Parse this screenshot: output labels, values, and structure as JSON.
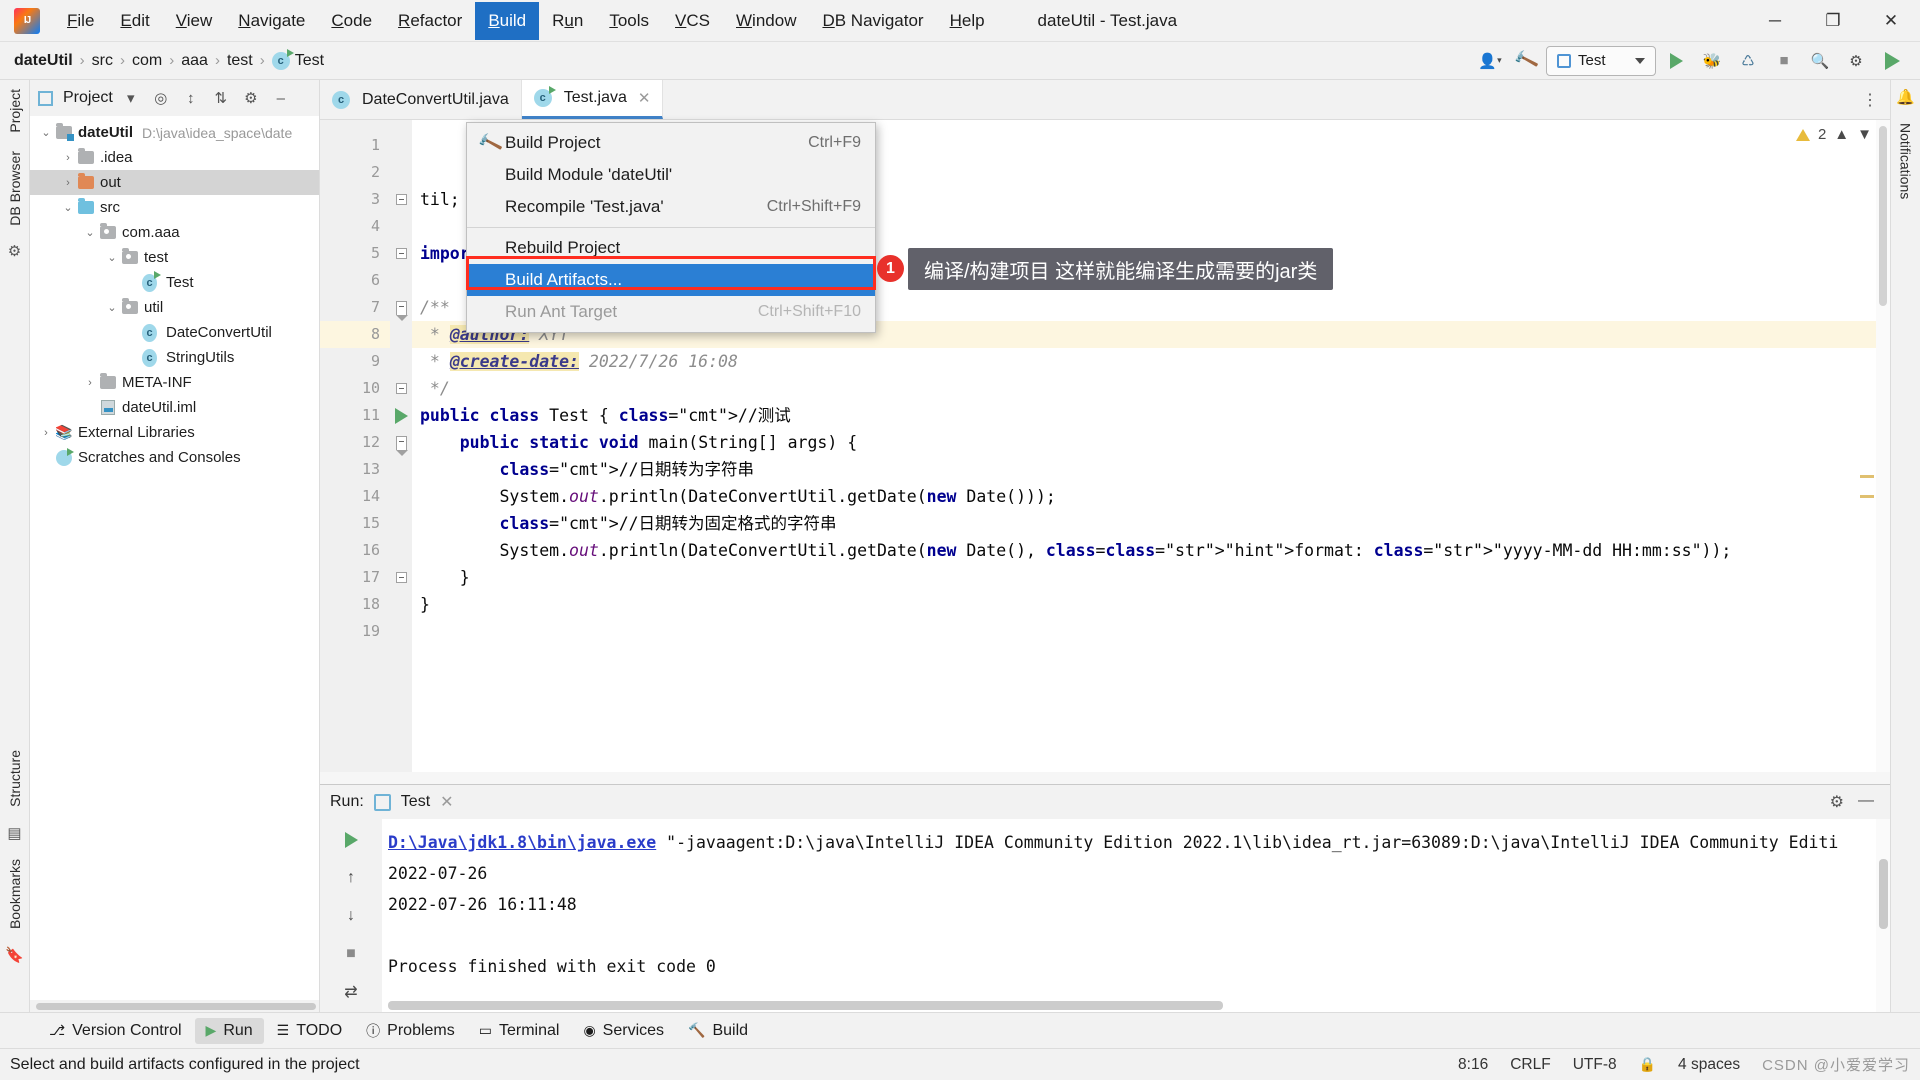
{
  "window": {
    "title": "dateUtil - Test.java"
  },
  "menubar": {
    "items": [
      {
        "label": "File",
        "accel": "F"
      },
      {
        "label": "Edit",
        "accel": "E"
      },
      {
        "label": "View",
        "accel": "V"
      },
      {
        "label": "Navigate",
        "accel": "N"
      },
      {
        "label": "Code",
        "accel": "C"
      },
      {
        "label": "Refactor",
        "accel": "R"
      },
      {
        "label": "Build",
        "accel": "B"
      },
      {
        "label": "Run",
        "accel": "u"
      },
      {
        "label": "Tools",
        "accel": "T"
      },
      {
        "label": "VCS",
        "accel": "V"
      },
      {
        "label": "Window",
        "accel": "W"
      },
      {
        "label": "DB Navigator",
        "accel": "D"
      },
      {
        "label": "Help",
        "accel": "H"
      }
    ],
    "active": "Build",
    "window_controls": {
      "minimize": "─",
      "maximize": "❐",
      "close": "✕"
    }
  },
  "build_menu": {
    "items": [
      {
        "label": "Build Project",
        "shortcut": "Ctrl+F9",
        "icon": "hammer-icon",
        "state": "normal"
      },
      {
        "label": "Build Module 'dateUtil'",
        "shortcut": "",
        "icon": "",
        "state": "normal"
      },
      {
        "label": "Recompile 'Test.java'",
        "shortcut": "Ctrl+Shift+F9",
        "icon": "",
        "state": "normal"
      },
      {
        "separator": true
      },
      {
        "label": "Rebuild Project",
        "shortcut": "",
        "icon": "",
        "state": "normal"
      },
      {
        "label": "Build Artifacts...",
        "shortcut": "",
        "icon": "",
        "state": "selected"
      },
      {
        "label": "Run Ant Target",
        "shortcut": "Ctrl+Shift+F10",
        "icon": "",
        "state": "disabled"
      }
    ],
    "highlight_color": "#ff2d1f",
    "selected_color": "#2b7fd4"
  },
  "annotation": {
    "badge": "1",
    "tooltip": "编译/构建项目 这样就能编译生成需要的jar类"
  },
  "navbar": {
    "breadcrumbs": [
      "dateUtil",
      "src",
      "com",
      "aaa",
      "test",
      "Test"
    ],
    "run_config": "Test",
    "icons": [
      "user-icon",
      "hammer-icon",
      "run-icon",
      "debug-icon",
      "coverage-icon",
      "stop-icon",
      "search-icon",
      "settings-icon",
      "updates-icon"
    ]
  },
  "project_panel": {
    "title": "Project",
    "toolbar_icons": [
      "chevron-down-icon",
      "locate-icon",
      "expand-all-icon",
      "collapse-all-icon",
      "gear-icon",
      "hide-icon"
    ],
    "tree": [
      {
        "label": "dateUtil",
        "path": "D:\\java\\idea_space\\date",
        "indent": 0,
        "arrow": "⌄",
        "icon": "module-folder",
        "bold": true,
        "selected": false
      },
      {
        "label": ".idea",
        "path": "",
        "indent": 1,
        "arrow": "›",
        "icon": "folder",
        "bold": false,
        "selected": false
      },
      {
        "label": "out",
        "path": "",
        "indent": 1,
        "arrow": "›",
        "icon": "folder-orange",
        "bold": false,
        "selected": true
      },
      {
        "label": "src",
        "path": "",
        "indent": 1,
        "arrow": "⌄",
        "icon": "folder-blue",
        "bold": false,
        "selected": false
      },
      {
        "label": "com.aaa",
        "path": "",
        "indent": 2,
        "arrow": "⌄",
        "icon": "package",
        "bold": false,
        "selected": false
      },
      {
        "label": "test",
        "path": "",
        "indent": 3,
        "arrow": "⌄",
        "icon": "package",
        "bold": false,
        "selected": false
      },
      {
        "label": "Test",
        "path": "",
        "indent": 4,
        "arrow": "",
        "icon": "class-run",
        "bold": false,
        "selected": false
      },
      {
        "label": "util",
        "path": "",
        "indent": 3,
        "arrow": "⌄",
        "icon": "package",
        "bold": false,
        "selected": false
      },
      {
        "label": "DateConvertUtil",
        "path": "",
        "indent": 4,
        "arrow": "",
        "icon": "class",
        "bold": false,
        "selected": false
      },
      {
        "label": "StringUtils",
        "path": "",
        "indent": 4,
        "arrow": "",
        "icon": "class",
        "bold": false,
        "selected": false
      },
      {
        "label": "META-INF",
        "path": "",
        "indent": 2,
        "arrow": "›",
        "icon": "folder",
        "bold": false,
        "selected": false
      },
      {
        "label": "dateUtil.iml",
        "path": "",
        "indent": 2,
        "arrow": "",
        "icon": "iml",
        "bold": false,
        "selected": false
      },
      {
        "label": "External Libraries",
        "path": "",
        "indent": 0,
        "arrow": "›",
        "icon": "library",
        "bold": false,
        "selected": false
      },
      {
        "label": "Scratches and Consoles",
        "path": "",
        "indent": 0,
        "arrow": "",
        "icon": "scratch",
        "bold": false,
        "selected": false
      }
    ]
  },
  "left_toolbar": {
    "tabs": [
      "Project",
      "DB Browser"
    ],
    "bottom_tabs": [
      "Structure",
      "Bookmarks"
    ]
  },
  "right_toolbar": {
    "tabs": [
      "Notifications"
    ]
  },
  "editor": {
    "tabs": [
      {
        "label": "DateConvertUtil.java",
        "active": false,
        "icon": "class-icon"
      },
      {
        "label": "Test.java",
        "active": true,
        "icon": "class-icon"
      }
    ],
    "inspection_count": "2",
    "lines": [
      {
        "n": "1",
        "text": "",
        "hl": false,
        "fold": ""
      },
      {
        "n": "2",
        "text": "",
        "hl": false,
        "fold": ""
      },
      {
        "n": "3",
        "text": "til;",
        "hl": false,
        "fold": "box"
      },
      {
        "n": "4",
        "text": "",
        "hl": false,
        "fold": ""
      },
      {
        "n": "5",
        "text": "import java.util.Date;",
        "hl": false,
        "fold": "box"
      },
      {
        "n": "6",
        "text": "",
        "hl": false,
        "fold": ""
      },
      {
        "n": "7",
        "text": "/**",
        "hl": false,
        "fold": "arrow"
      },
      {
        "n": "8",
        "text": " * @author: XYT",
        "hl": true,
        "fold": ""
      },
      {
        "n": "9",
        "text": " * @create-date: 2022/7/26 16:08",
        "hl": false,
        "fold": ""
      },
      {
        "n": "10",
        "text": " */",
        "hl": false,
        "fold": "box"
      },
      {
        "n": "11",
        "text": "public class Test { //测试",
        "hl": false,
        "fold": "",
        "runmark": true
      },
      {
        "n": "12",
        "text": "    public static void main(String[] args) {",
        "hl": false,
        "fold": "arrow",
        "runmark": true
      },
      {
        "n": "13",
        "text": "        //日期转为字符串",
        "hl": false,
        "fold": ""
      },
      {
        "n": "14",
        "text": "        System.out.println(DateConvertUtil.getDate(new Date()));",
        "hl": false,
        "fold": ""
      },
      {
        "n": "15",
        "text": "        //日期转为固定格式的字符串",
        "hl": false,
        "fold": ""
      },
      {
        "n": "16",
        "text": "        System.out.println(DateConvertUtil.getDate(new Date(), format: \"yyyy-MM-dd HH:mm:ss\"));",
        "hl": false,
        "fold": ""
      },
      {
        "n": "17",
        "text": "    }",
        "hl": false,
        "fold": "box"
      },
      {
        "n": "18",
        "text": "}",
        "hl": false,
        "fold": ""
      },
      {
        "n": "19",
        "text": "",
        "hl": false,
        "fold": ""
      }
    ],
    "param_hint": "format:"
  },
  "run_panel": {
    "label": "Run:",
    "tab": "Test",
    "tools": [
      "rerun-icon",
      "up-icon",
      "down-icon",
      "stop-icon",
      "soft-wrap-icon"
    ],
    "header_icons": [
      "gear-icon",
      "minimize-icon"
    ],
    "console": [
      {
        "type": "mixed",
        "link": "D:\\Java\\jdk1.8\\bin\\java.exe",
        "rest": " \"-javaagent:D:\\java\\IntelliJ IDEA Community Edition 2022.1\\lib\\idea_rt.jar=63089:D:\\java\\IntelliJ IDEA Community Editi"
      },
      {
        "type": "plain",
        "text": "2022-07-26"
      },
      {
        "type": "plain",
        "text": "2022-07-26 16:11:48"
      },
      {
        "type": "plain",
        "text": ""
      },
      {
        "type": "plain",
        "text": "Process finished with exit code 0"
      }
    ]
  },
  "bottom_tabs": [
    {
      "label": "Version Control",
      "icon": "branch-icon",
      "active": false
    },
    {
      "label": "Run",
      "icon": "run-icon",
      "active": true
    },
    {
      "label": "TODO",
      "icon": "list-icon",
      "active": false
    },
    {
      "label": "Problems",
      "icon": "warning-icon",
      "active": false
    },
    {
      "label": "Terminal",
      "icon": "terminal-icon",
      "active": false
    },
    {
      "label": "Services",
      "icon": "services-icon",
      "active": false
    },
    {
      "label": "Build",
      "icon": "hammer-icon",
      "active": false
    }
  ],
  "statusbar": {
    "message": "Select and build artifacts configured in the project",
    "caret": "8:16",
    "line_sep": "CRLF",
    "encoding": "UTF-8",
    "indent": "4 spaces",
    "lock_icon": "lock-icon",
    "watermark": "CSDN @小爱爱学习"
  }
}
